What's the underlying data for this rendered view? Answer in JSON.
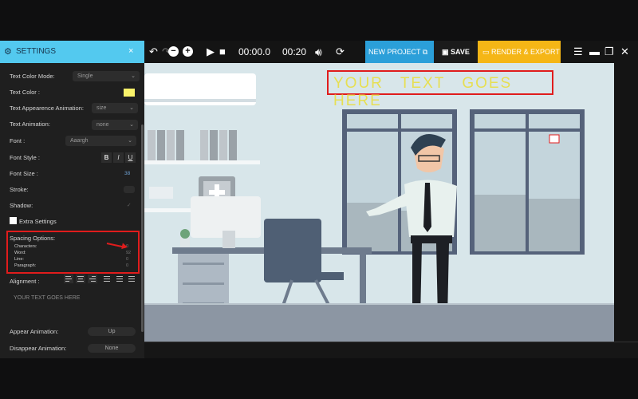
{
  "toolbar": {
    "undo_icon": "undo-icon",
    "redo_icon": "redo-icon",
    "zoom_out": "−",
    "zoom_in": "+",
    "time_current": "00:00.0",
    "time_total": "00:20",
    "new_project_label": "NEW PROJECT",
    "save_label": "SAVE",
    "render_label": "RENDER & EXPORT",
    "colors": {
      "new_project": "#2b9fd9",
      "render": "#f5b616"
    }
  },
  "panel": {
    "title": "SETTINGS",
    "close": "×",
    "text_color_mode_label": "Text Color Mode:",
    "text_color_mode_value": "Single",
    "text_color_label": "Text Color :",
    "text_color_value": "#f9f26a",
    "appearance_anim_label": "Text Appearence Animation:",
    "appearance_anim_value": "size",
    "text_anim_label": "Text Animation:",
    "text_anim_value": "none",
    "font_label": "Font :",
    "font_value": "Aaargh",
    "font_style_label": "Font Style :",
    "font_style_bold": "B",
    "font_style_italic": "I",
    "font_style_underline": "U",
    "font_size_label": "Font Size :",
    "font_size_value": "38",
    "stroke_label": "Stroke:",
    "shadow_label": "Shadow:",
    "extra_settings_label": "Extra Settings",
    "spacing": {
      "title": "Spacing Options:",
      "items": [
        {
          "label": "Characters:",
          "value": "0"
        },
        {
          "label": "Word:",
          "value": "92"
        },
        {
          "label": "Line:",
          "value": "0"
        },
        {
          "label": "Paragraph:",
          "value": "0"
        }
      ]
    },
    "alignment_label": "Alignment :",
    "placeholder_text": "YOUR TEXT GOES HERE",
    "appear_anim_label": "Appear Animation:",
    "appear_anim_value": "Up",
    "disappear_anim_label": "Disappear Animation:",
    "disappear_anim_value": "None"
  },
  "canvas": {
    "headline": "YOUR TEXT GOES HERE",
    "headline_color": "#e7df52"
  }
}
